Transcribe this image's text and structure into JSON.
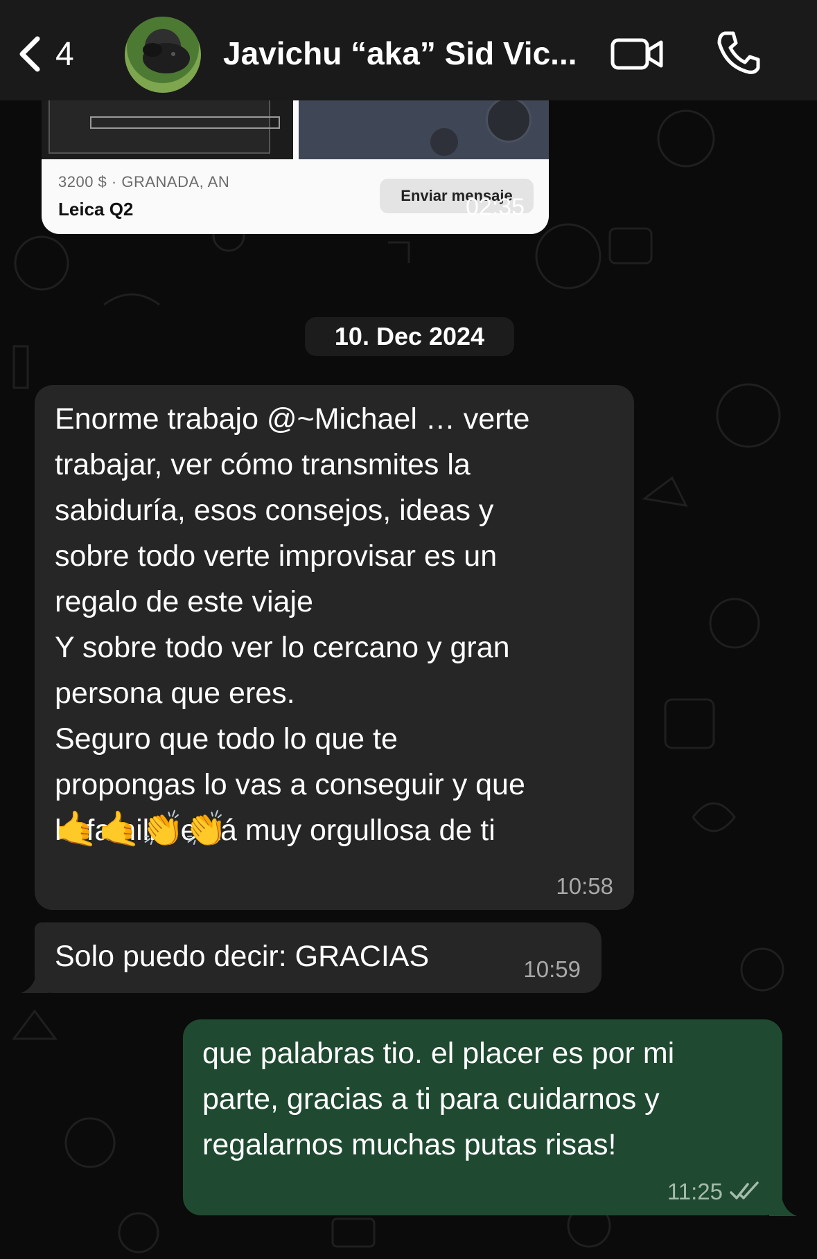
{
  "header": {
    "back_count": "4",
    "contact_name": "Javichu “aka” Sid Vic...",
    "icons": [
      "chevron-left-icon",
      "video-camera-icon",
      "phone-icon"
    ]
  },
  "product_card": {
    "price_location": "3200 $ · GRANADA, AN",
    "title": "Leica Q2",
    "button_label": "Enviar mensaje",
    "time": "02:35"
  },
  "date_separator": "10. Dec 2024",
  "messages": [
    {
      "direction": "incoming",
      "text": "Enorme trabajo @~Michael … verte\ntrabajar, ver cómo transmites la\nsabiduría, esos consejos, ideas y\nsobre todo verte improvisar es un\nregalo de este viaje\nY sobre todo ver lo cercano y gran\npersona que eres.\nSeguro que todo lo que te\npropongas lo vas a conseguir y que\nla familia está muy orgullosa de ti",
      "emojis": "🤙🤙👏👏",
      "time": "10:58"
    },
    {
      "direction": "incoming",
      "text": "Solo puedo decir: GRACIAS",
      "time": "10:59"
    },
    {
      "direction": "outgoing",
      "text": "que palabras tio. el placer es por mi\nparte, gracias a ti para cuidarnos y\nregalarnos muchas putas risas!",
      "time": "11:25",
      "status_icon": "double-check-icon"
    }
  ],
  "colors": {
    "header_bg": "#1a1a1a",
    "incoming_bubble": "#262626",
    "outgoing_bubble": "#1f4a31",
    "background": "#0b0b0b"
  }
}
